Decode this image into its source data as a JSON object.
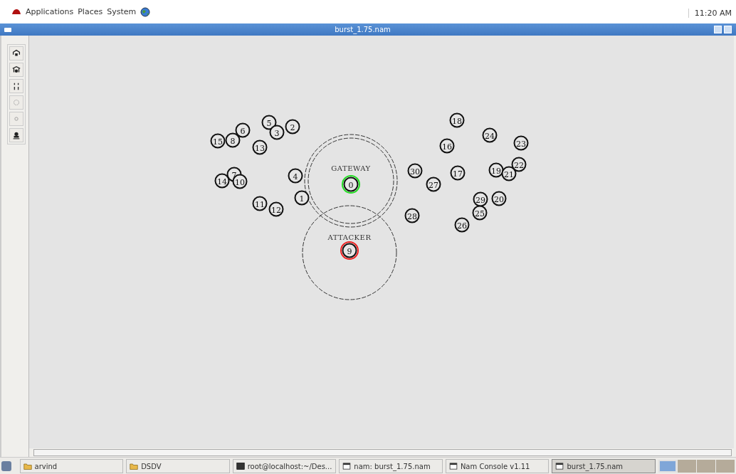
{
  "top_panel": {
    "menus": [
      "Applications",
      "Places",
      "System"
    ],
    "clock": "11:20 AM"
  },
  "window": {
    "title": "burst_1.75.nam"
  },
  "canvas": {
    "ranges": [
      {
        "label": "GATEWAY",
        "kind": "double"
      },
      {
        "label": "ATTACKER",
        "kind": "single"
      }
    ],
    "nodes": [
      {
        "label": "15"
      },
      {
        "label": "8"
      },
      {
        "label": "6"
      },
      {
        "label": "5"
      },
      {
        "label": "3"
      },
      {
        "label": "2"
      },
      {
        "label": "13"
      },
      {
        "label": "7"
      },
      {
        "label": "14"
      },
      {
        "label": "10"
      },
      {
        "label": "4"
      },
      {
        "label": "1"
      },
      {
        "label": "11"
      },
      {
        "label": "12"
      },
      {
        "label": "0",
        "color": "#22dd22"
      },
      {
        "label": "9",
        "color": "#ee2222"
      },
      {
        "label": "18"
      },
      {
        "label": "24"
      },
      {
        "label": "23"
      },
      {
        "label": "16"
      },
      {
        "label": "30"
      },
      {
        "label": "27"
      },
      {
        "label": "17"
      },
      {
        "label": "19"
      },
      {
        "label": "22"
      },
      {
        "label": "21"
      },
      {
        "label": "29"
      },
      {
        "label": "20"
      },
      {
        "label": "25"
      },
      {
        "label": "28"
      },
      {
        "label": "26"
      }
    ]
  },
  "taskbar": {
    "items": [
      {
        "label": "arvind",
        "kind": "folder",
        "selected": false
      },
      {
        "label": "DSDV",
        "kind": "folder",
        "selected": false
      },
      {
        "label": "root@localhost:~/Des...",
        "kind": "terminal",
        "selected": false
      },
      {
        "label": "nam: burst_1.75.nam",
        "kind": "window",
        "selected": false
      },
      {
        "label": "Nam Console v1.11",
        "kind": "window",
        "selected": false
      },
      {
        "label": "burst_1.75.nam",
        "kind": "window",
        "selected": true
      }
    ]
  }
}
